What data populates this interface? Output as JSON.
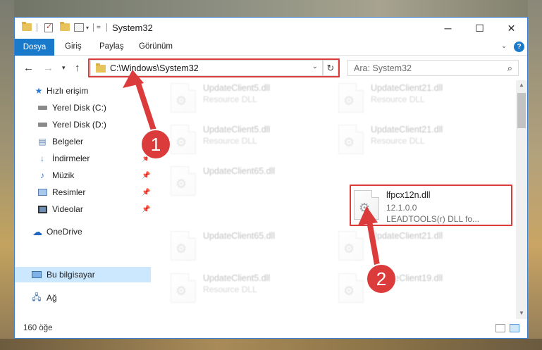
{
  "window": {
    "title": "System32"
  },
  "ribbon": {
    "tabs": [
      "Dosya",
      "Giriş",
      "Paylaş",
      "Görünüm"
    ],
    "expand_icon": "chevron-down-icon",
    "help_label": "?"
  },
  "nav": {
    "address": "C:\\Windows\\System32",
    "search_placeholder": "Ara: System32"
  },
  "sidebar": {
    "items": [
      {
        "label": "Hızlı erişim",
        "icon": "star-icon",
        "pinned": false
      },
      {
        "label": "Yerel Disk (C:)",
        "icon": "drive-icon",
        "pinned": false
      },
      {
        "label": "Yerel Disk (D:)",
        "icon": "drive-icon",
        "pinned": false
      },
      {
        "label": "Belgeler",
        "icon": "document-icon",
        "pinned": false
      },
      {
        "label": "İndirmeler",
        "icon": "download-icon",
        "pinned": true
      },
      {
        "label": "Müzik",
        "icon": "music-icon",
        "pinned": true
      },
      {
        "label": "Resimler",
        "icon": "pictures-icon",
        "pinned": true
      },
      {
        "label": "Videolar",
        "icon": "video-icon",
        "pinned": true
      },
      {
        "label": "OneDrive",
        "icon": "cloud-icon",
        "pinned": false
      },
      {
        "label": "Bu bilgisayar",
        "icon": "computer-icon",
        "pinned": false,
        "selected": true
      },
      {
        "label": "Ağ",
        "icon": "network-icon",
        "pinned": false
      }
    ]
  },
  "files": {
    "blurred": [
      {
        "name": "UpdateClient5.dll",
        "type": "Resource DLL"
      },
      {
        "name": "UpdateClient21.dll",
        "type": "Resource DLL"
      },
      {
        "name": "UpdateClient5.dll",
        "type": "Resource DLL"
      },
      {
        "name": "UpdateClient21.dll",
        "type": "Resource DLL"
      },
      {
        "name": "UpdateClient65.dll",
        "type": "Resource DLL"
      },
      {
        "name": "UpdateClient65.dll",
        "type": "Resource DLL"
      },
      {
        "name": "UpdateClient21.dll",
        "type": "Resource DLL"
      },
      {
        "name": "UpdateClient5.dll",
        "type": "Resource DLL"
      },
      {
        "name": "UpdateClient19.dll",
        "type": "Resource DLL"
      }
    ],
    "highlighted": {
      "name": "lfpcx12n.dll",
      "version": "12.1.0.0",
      "description": "LEADTOOLS(r) DLL fo..."
    }
  },
  "status": {
    "item_count": "160 öğe"
  },
  "annotations": {
    "step1": "1",
    "step2": "2",
    "color": "#dc3b3b"
  }
}
